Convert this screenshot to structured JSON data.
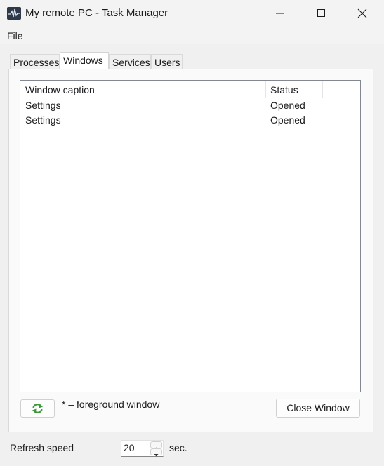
{
  "window": {
    "title": "My remote PC - Task Manager",
    "icon": "app-waveform-icon",
    "controls": [
      "minimize-icon",
      "maximize-icon",
      "close-icon"
    ]
  },
  "menu": {
    "file": "File"
  },
  "tabs": [
    {
      "label": "Processes",
      "selected": false
    },
    {
      "label": "Windows",
      "selected": true
    },
    {
      "label": "Services",
      "selected": false
    },
    {
      "label": "Users",
      "selected": false
    }
  ],
  "windows_list": {
    "columns": [
      "Window caption",
      "Status"
    ],
    "rows": [
      {
        "caption": "Settings",
        "status": "Opened"
      },
      {
        "caption": "Settings",
        "status": "Opened"
      }
    ]
  },
  "footer": {
    "refresh_icon": "refresh-icon",
    "legend": "* – foreground window",
    "close_window_label": "Close Window"
  },
  "refresh": {
    "label": "Refresh speed",
    "value": "20",
    "units": "sec."
  },
  "colors": {
    "refresh_icon": "#3a9a3a",
    "app_icon": "#2e3a4a"
  }
}
